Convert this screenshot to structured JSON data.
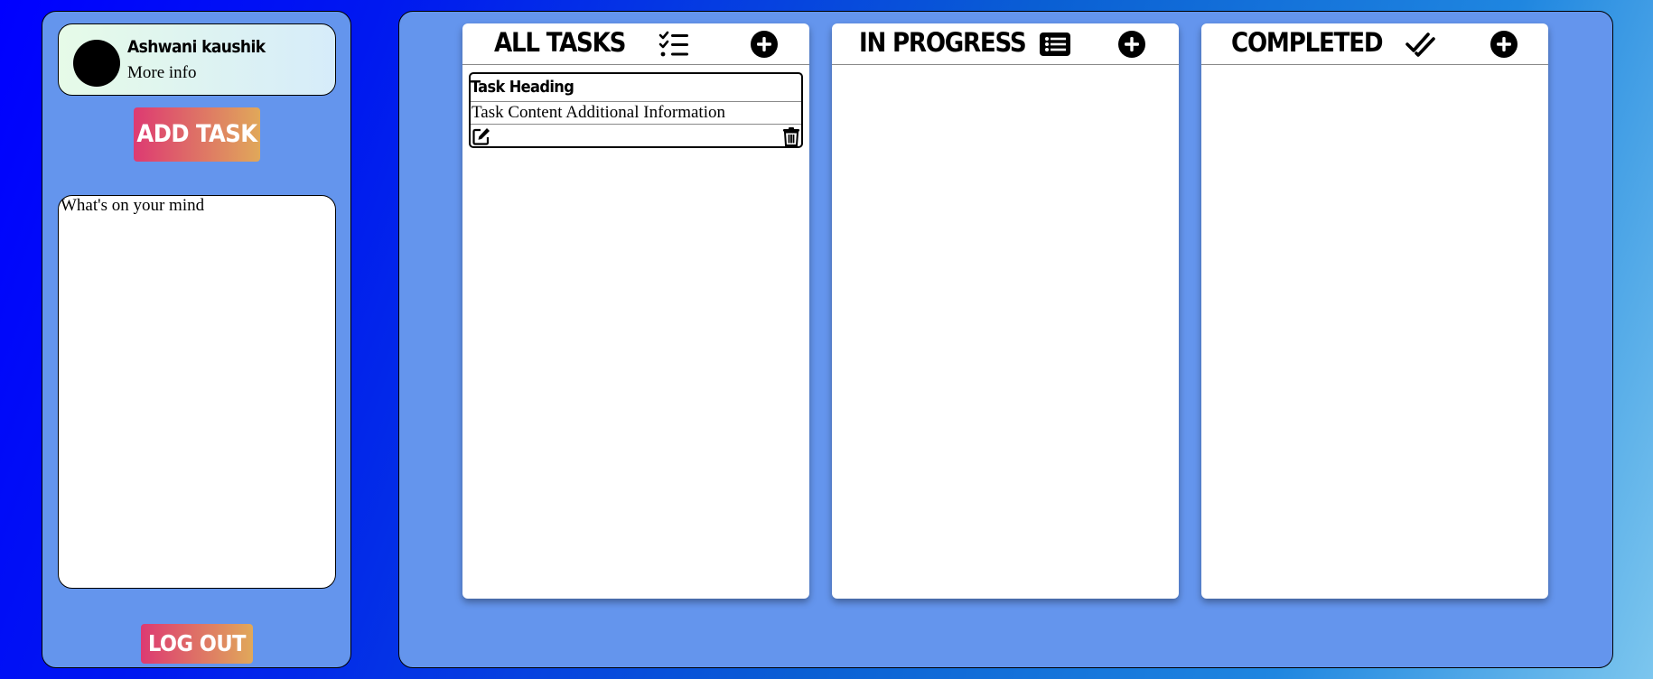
{
  "sidebar": {
    "profile": {
      "name": "Ashwani kaushik",
      "more_info": "More info"
    },
    "add_task_label": "ADD TASK",
    "notes_placeholder": "What's on your mind",
    "logout_label": "LOG OUT"
  },
  "board": {
    "columns": [
      {
        "title": "ALL TASKS",
        "icon": "checklist-icon",
        "add_icon": "plus-circle-icon"
      },
      {
        "title": "IN PROGRESS",
        "icon": "list-icon",
        "add_icon": "plus-circle-icon"
      },
      {
        "title": "COMPLETED",
        "icon": "double-check-icon",
        "add_icon": "plus-circle-icon"
      }
    ],
    "tasks": [
      {
        "heading": "Task Heading",
        "content": "Task Content Additional Information",
        "edit_icon": "edit-icon",
        "delete_icon": "trash-icon"
      }
    ]
  },
  "colors": {
    "panel": "#6495ed",
    "button_gradient_start": "#dd3a72",
    "button_gradient_end": "#e0a85a",
    "text": "#000000"
  }
}
